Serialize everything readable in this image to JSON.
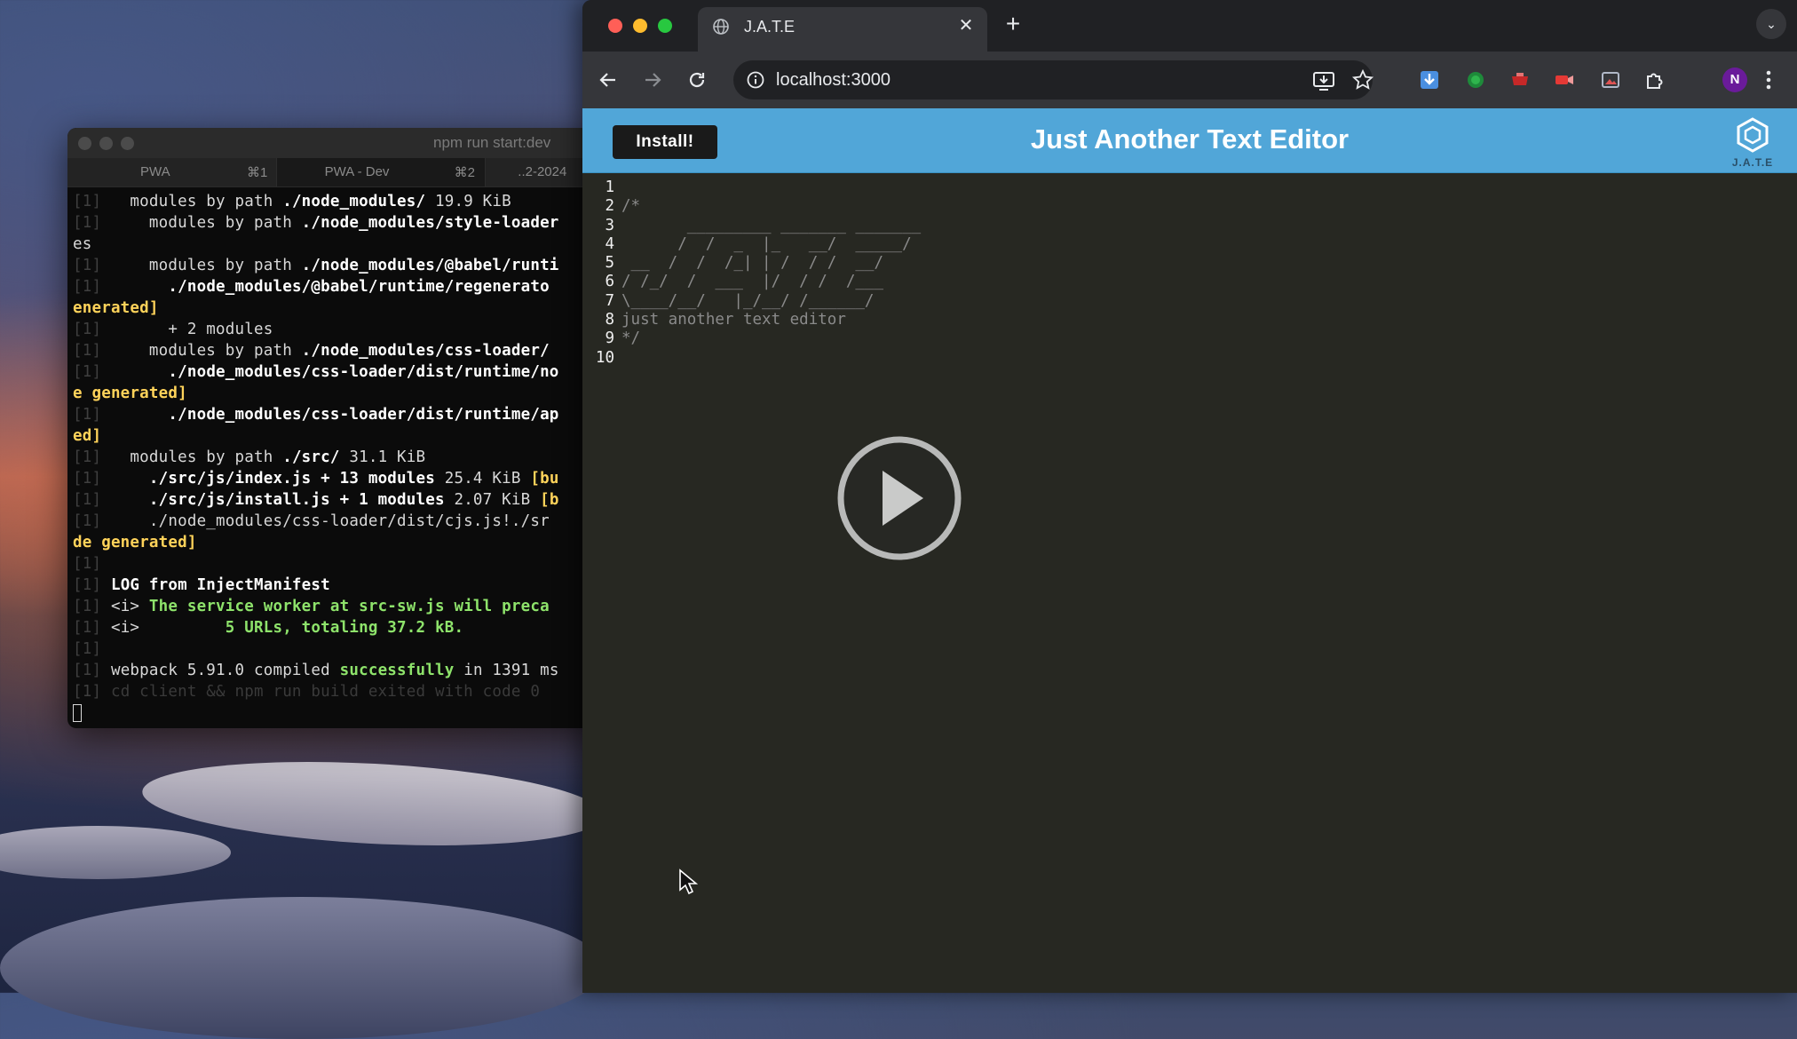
{
  "terminal": {
    "title": "npm run start:dev",
    "tabs": [
      {
        "label": "PWA",
        "shortcut": "⌘1"
      },
      {
        "label": "PWA - Dev",
        "shortcut": "⌘2"
      },
      {
        "label": "..2-2024",
        "shortcut": ""
      }
    ],
    "lines": [
      [
        {
          "t": "[1] ",
          "c": "p"
        },
        {
          "t": "  modules by path "
        },
        {
          "t": "./node_modules/",
          "c": "b"
        },
        {
          "t": " 19.9 KiB"
        }
      ],
      [
        {
          "t": "[1] ",
          "c": "p"
        },
        {
          "t": "    modules by path "
        },
        {
          "t": "./node_modules/style-loader",
          "c": "b"
        }
      ],
      [
        {
          "t": "es"
        }
      ],
      [
        {
          "t": "[1] ",
          "c": "p"
        },
        {
          "t": "    modules by path "
        },
        {
          "t": "./node_modules/@babel/runti",
          "c": "b"
        }
      ],
      [
        {
          "t": "[1] ",
          "c": "p"
        },
        {
          "t": "      "
        },
        {
          "t": "./node_modules/@babel/runtime/regenerato",
          "c": "b"
        }
      ],
      [
        {
          "t": "enerated]",
          "c": "y"
        }
      ],
      [
        {
          "t": "[1] ",
          "c": "p"
        },
        {
          "t": "      + 2 modules"
        }
      ],
      [
        {
          "t": "[1] ",
          "c": "p"
        },
        {
          "t": "    modules by path "
        },
        {
          "t": "./node_modules/css-loader/",
          "c": "b"
        }
      ],
      [
        {
          "t": "[1] ",
          "c": "p"
        },
        {
          "t": "      "
        },
        {
          "t": "./node_modules/css-loader/dist/runtime/no",
          "c": "b"
        }
      ],
      [
        {
          "t": "e generated]",
          "c": "y"
        }
      ],
      [
        {
          "t": "[1] ",
          "c": "p"
        },
        {
          "t": "      "
        },
        {
          "t": "./node_modules/css-loader/dist/runtime/ap",
          "c": "b"
        }
      ],
      [
        {
          "t": "ed]",
          "c": "y"
        }
      ],
      [
        {
          "t": "[1] ",
          "c": "p"
        },
        {
          "t": "  modules by path "
        },
        {
          "t": "./src/",
          "c": "b"
        },
        {
          "t": " 31.1 KiB"
        }
      ],
      [
        {
          "t": "[1] ",
          "c": "p"
        },
        {
          "t": "    "
        },
        {
          "t": "./src/js/index.js + 13 modules",
          "c": "b"
        },
        {
          "t": " 25.4 KiB "
        },
        {
          "t": "[bu",
          "c": "y"
        }
      ],
      [
        {
          "t": "[1] ",
          "c": "p"
        },
        {
          "t": "    "
        },
        {
          "t": "./src/js/install.js + 1 modules",
          "c": "b"
        },
        {
          "t": " 2.07 KiB "
        },
        {
          "t": "[b",
          "c": "y"
        }
      ],
      [
        {
          "t": "[1] ",
          "c": "p"
        },
        {
          "t": "    ./node_modules/css-loader/dist/cjs.js!./sr"
        }
      ],
      [
        {
          "t": "de generated]",
          "c": "y"
        }
      ],
      [
        {
          "t": "[1]",
          "c": "p"
        }
      ],
      [
        {
          "t": "[1] ",
          "c": "p"
        },
        {
          "t": "LOG from InjectManifest",
          "c": "b"
        }
      ],
      [
        {
          "t": "[1] ",
          "c": "p"
        },
        {
          "t": "<i> "
        },
        {
          "t": "The service worker at src-sw.js will preca",
          "c": "g"
        }
      ],
      [
        {
          "t": "[1] ",
          "c": "p"
        },
        {
          "t": "<i>         "
        },
        {
          "t": "5 URLs, totaling 37.2 kB.",
          "c": "g"
        }
      ],
      [
        {
          "t": "[1]",
          "c": "p"
        }
      ],
      [
        {
          "t": "[1] ",
          "c": "p"
        },
        {
          "t": "webpack 5.91.0 compiled "
        },
        {
          "t": "successfully",
          "c": "g"
        },
        {
          "t": " in 1391 ms"
        }
      ],
      [
        {
          "t": "[1] ",
          "c": "p"
        },
        {
          "t": "cd client && npm run build exited with code 0",
          "c": "dim"
        }
      ]
    ]
  },
  "browser": {
    "tab_title": "J.A.T.E",
    "url": "localhost:3000",
    "profile_initial": "N",
    "tab_close": "✕",
    "new_tab": "+",
    "tab_search": "⌄"
  },
  "app": {
    "install_label": "Install!",
    "title": "Just Another Text Editor",
    "logo_text": "J.A.T.E",
    "accent": "#51a6d8"
  },
  "editor": {
    "lines": [
      "",
      "/*",
      "       _________ _______ _______",
      "      /  /  _  |_   __/  _____/",
      " __  /  /  /_| | /  / /  __/",
      "/ /_/  /  ___  |/  / /  /___",
      "\\____/__/   |_/__/ /______/",
      "just another text editor",
      "*/",
      ""
    ]
  }
}
